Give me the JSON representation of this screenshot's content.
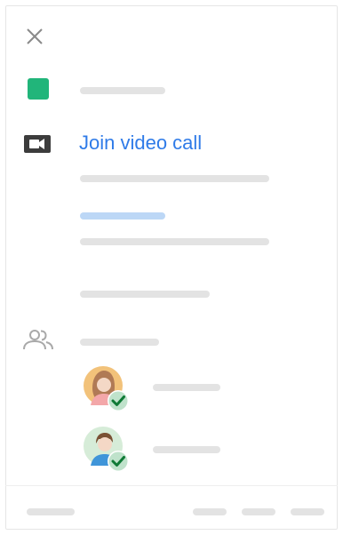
{
  "dialog": {
    "close_icon": "close-icon",
    "event_color": "#21b57a",
    "video_call": {
      "icon": "video-camera-icon",
      "label": "Join video call",
      "link_color": "#2f7be8"
    },
    "guests_icon": "people-icon",
    "guests": [
      {
        "avatar": "female-avatar",
        "status": "accepted",
        "status_color": "#34a853"
      },
      {
        "avatar": "male-avatar",
        "status": "accepted",
        "status_color": "#34a853"
      }
    ]
  }
}
